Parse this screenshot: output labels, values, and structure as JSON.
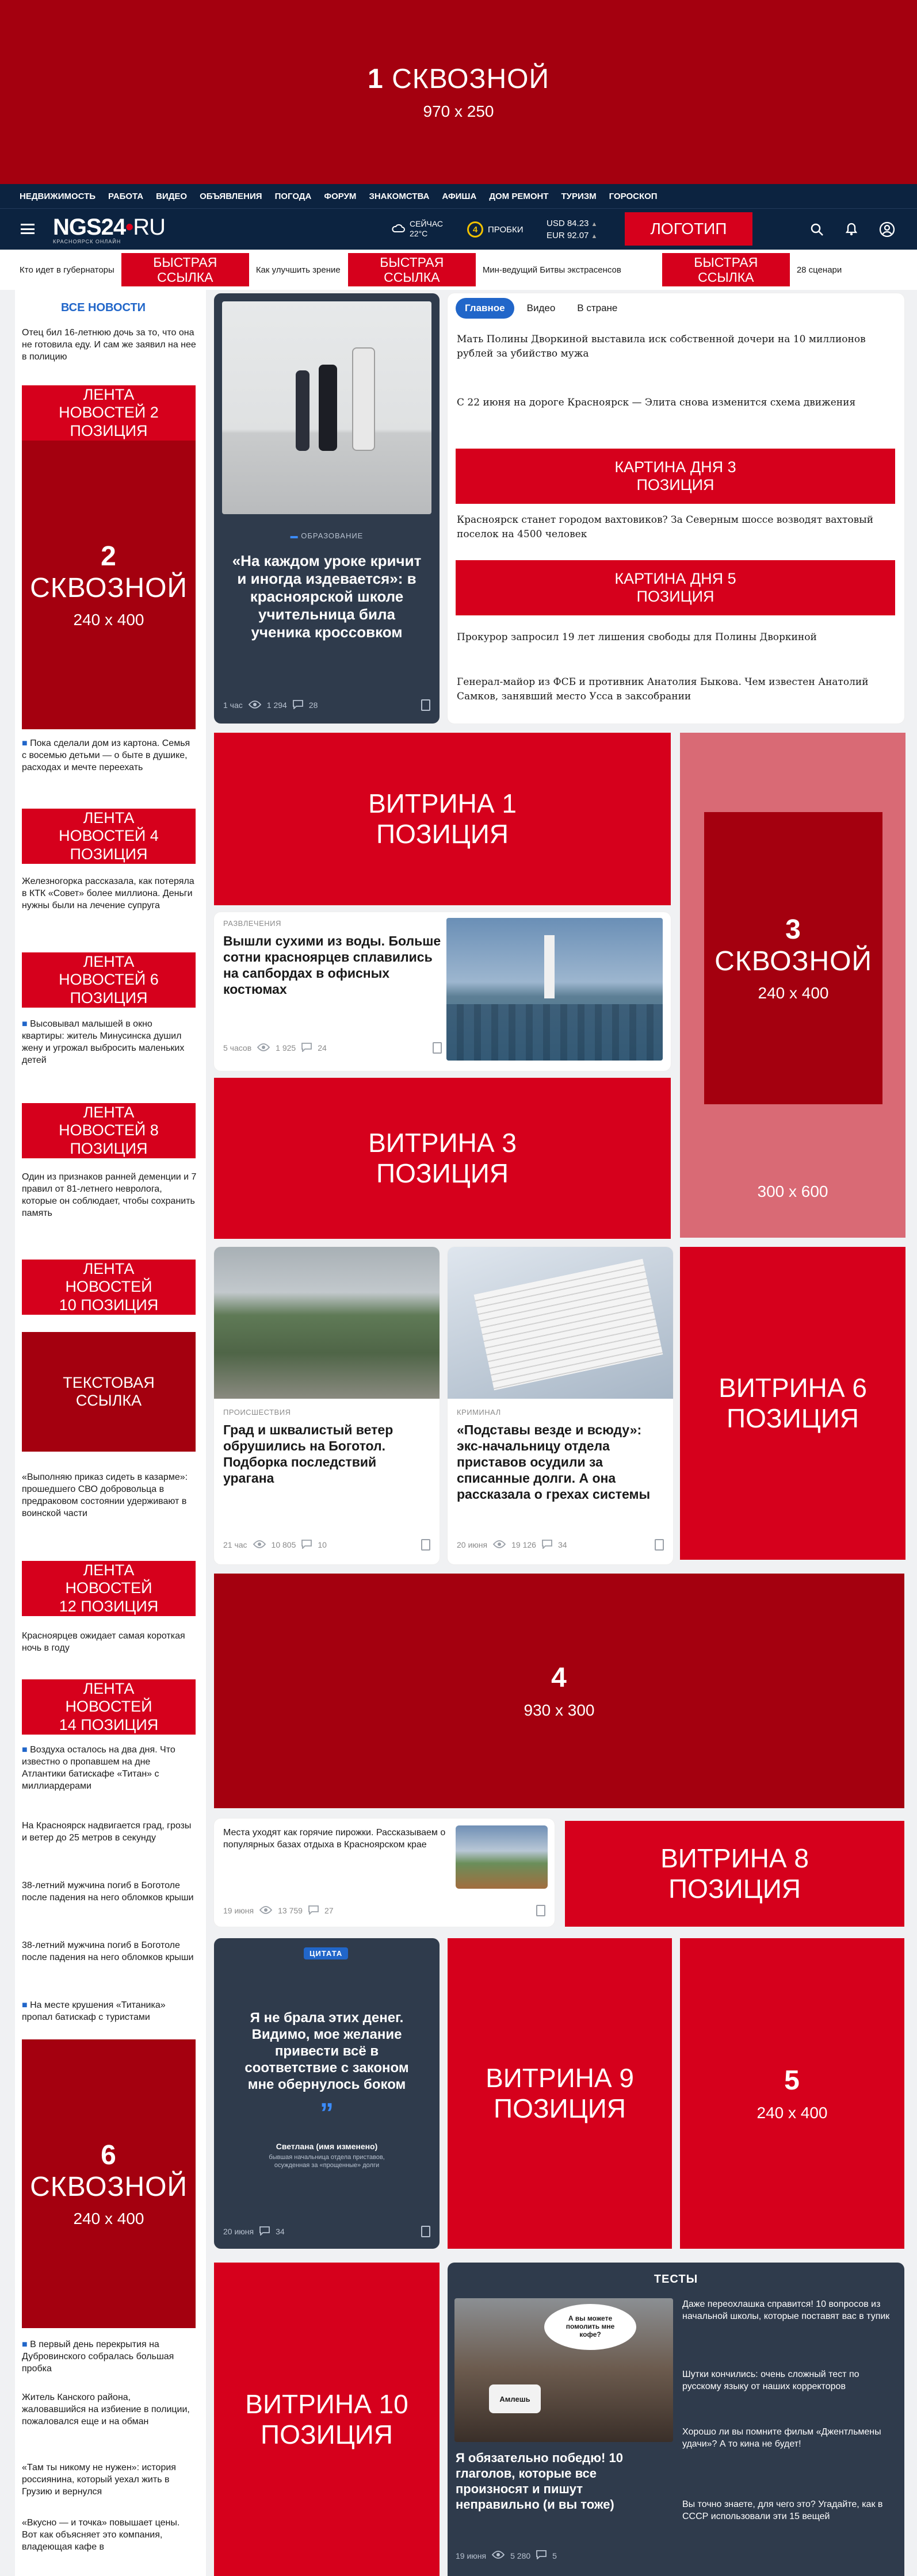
{
  "ads": {
    "top": {
      "num": "1",
      "label": "СКВОЗНОЙ",
      "size": "970 x 250"
    },
    "side2": {
      "num": "2",
      "label": "СКВОЗНОЙ",
      "size": "240 x 400"
    },
    "right3": {
      "num": "3",
      "label": "СКВОЗНОЙ",
      "size": "240 x 400",
      "outer": "300 x 600"
    },
    "wide4": {
      "num": "4",
      "size": "930 x 300"
    },
    "five": {
      "num": "5",
      "size": "240 x 400"
    },
    "side6": {
      "num": "6",
      "label": "СКВОЗНОЙ",
      "size": "240 x 400"
    }
  },
  "topnav": [
    "НЕДВИЖИМОСТЬ",
    "РАБОТА",
    "ВИДЕО",
    "ОБЪЯВЛЕНИЯ",
    "ПОГОДА",
    "ФОРУМ",
    "ЗНАКОМСТВА",
    "АФИША",
    "ДОМ РЕМОНТ",
    "ТУРИЗМ",
    "ГОРОСКОП"
  ],
  "header": {
    "logo": "NGS24",
    "logo_dot": "•",
    "logo_ru": "RU",
    "logo_sub": "КРАСНОЯРСК ОНЛАЙН",
    "weather_label": "СЕЙЧАС",
    "weather_temp": "22°C",
    "traffic_num": "4",
    "traffic_label": "ПРОБКИ",
    "usd": "USD 84.23",
    "eur": "EUR 92.07",
    "logo_btn": "ЛОГОТИП"
  },
  "quicklinks": [
    {
      "text": "Кто идет в губернаторы",
      "ad": false
    },
    {
      "text": "БЫСТРАЯ ССЫЛКА",
      "ad": true
    },
    {
      "text": "Как улучшить зрение",
      "ad": false
    },
    {
      "text": "БЫСТРАЯ ССЫЛКА",
      "ad": true
    },
    {
      "text": "Мин-ведущий Битвы экстрасенсов",
      "ad": false
    },
    {
      "text": "БЫСТРАЯ ССЫЛКА",
      "ad": true
    },
    {
      "text": "28 сценари",
      "ad": false
    }
  ],
  "sidebar": {
    "all_news": "ВСЕ НОВОСТИ",
    "items": [
      {
        "type": "text",
        "text": "Отец бил 16-летнюю дочь за то, что она не готовила еду. И сам же заявил на нее в полицию"
      },
      {
        "type": "ad",
        "text": "ЛЕНТА НОВОСТЕЙ 2 ПОЗИЦИЯ"
      },
      {
        "type": "text",
        "text": "Пока сделали дом из картона. Семья с восемью детьми — о быте в душике, расходах и мечте переехать"
      },
      {
        "type": "ad",
        "text": "ЛЕНТА НОВОСТЕЙ 4 ПОЗИЦИЯ"
      },
      {
        "type": "text",
        "text": "Железногорка рассказала, как потеряла в КТК «Совет» более миллиона. Деньги нужны были на лечение супруга"
      },
      {
        "type": "ad",
        "text": "ЛЕНТА НОВОСТЕЙ 6 ПОЗИЦИЯ"
      },
      {
        "type": "text",
        "text": "Высовывал малышей в окно квартиры: житель Минусинска душил жену и угрожал выбросить маленьких детей"
      },
      {
        "type": "ad",
        "text": "ЛЕНТА НОВОСТЕЙ 8 ПОЗИЦИЯ"
      },
      {
        "type": "text",
        "text": "Один из признаков ранней деменции и 7 правил от 81-летнего невролога, которые он соблюдает, чтобы сохранить память"
      },
      {
        "type": "ad",
        "text": "ЛЕНТА НОВОСТЕЙ 10 ПОЗИЦИЯ"
      },
      {
        "type": "ad",
        "text": "ТЕКСТОВАЯ ССЫЛКА"
      },
      {
        "type": "text",
        "text": "«Выполняю приказ сидеть в казарме»: прошедшего СВО добровольца в предраковом состоянии удерживают в воинской части"
      },
      {
        "type": "ad",
        "text": "ЛЕНТА НОВОСТЕЙ 12 ПОЗИЦИЯ"
      },
      {
        "type": "text",
        "text": "Красноярцев ожидает самая короткая ночь в году"
      },
      {
        "type": "ad",
        "text": "ЛЕНТА НОВОСТЕЙ 14 ПОЗИЦИЯ"
      },
      {
        "type": "text",
        "text": "Воздуха осталось на два дня. Что известно о пропавшем на дне Атлантики батискафе «Титан» с миллиардерами"
      },
      {
        "type": "text",
        "text": "На Красноярск надвигается град, грозы и ветер до 25 метров в секунду"
      },
      {
        "type": "text",
        "text": "38-летний мужчина погиб в Боготоле после падения на него обломков крыши"
      },
      {
        "type": "text",
        "text": "38-летний мужчина погиб в Боготоле после падения на него обломков крыши"
      },
      {
        "type": "text",
        "text": "На месте крушения «Титаника» пропал батискаф с туристами"
      },
      {
        "type": "text",
        "text": "В первый день перекрытия на Дубровинского собралась большая пробка"
      },
      {
        "type": "text",
        "text": "Житель Канского района, жаловавшийся на избиение в полиции, пожаловался еще и на обман"
      },
      {
        "type": "text",
        "text": "«Там ты никому не нужен»: история россиянина, который уехал жить в Грузию и вернулся"
      },
      {
        "type": "text",
        "text": "«Вкусно — и точка» повышает цены. Вот как объясняет это компания, владеющая кафе в"
      }
    ]
  },
  "hero": {
    "category": "ОБРАЗОВАНИЕ",
    "title": "«На каждом уроке кричит и иногда издевается»: в красноярской школе учительница била ученика кроссовком",
    "time": "1 час",
    "views": "1 294",
    "comments": "28"
  },
  "tabs": [
    "Главное",
    "Видео",
    "В стране"
  ],
  "headlines": [
    {
      "type": "text",
      "text": "Мать Полины Дворкиной выставила иск собственной дочери на 10 миллионов рублей за убийство мужа"
    },
    {
      "type": "text",
      "text": "С 22 июня на дороге Красноярск — Элита снова изменится схема движения"
    },
    {
      "type": "ad",
      "text": "КАРТИНА ДНЯ 3 ПОЗИЦИЯ"
    },
    {
      "type": "text",
      "text": "Красноярск станет городом вахтовиков? За Северным шоссе возводят вахтовый поселок на 4500 человек"
    },
    {
      "type": "ad",
      "text": "КАРТИНА ДНЯ 5 ПОЗИЦИЯ"
    },
    {
      "type": "text",
      "text": "Прокурор запросил 19 лет лишения свободы для Полины Дворкиной"
    },
    {
      "type": "text",
      "text": "Генерал-майор из ФСБ и противник Анатолия Быкова. Чем известен Анатолий Самков, занявший место Усса в заксобрании"
    }
  ],
  "vitrina": {
    "v1": "ВИТРИНА 1 ПОЗИЦИЯ",
    "v3": "ВИТРИНА 3 ПОЗИЦИЯ",
    "v6": "ВИТРИНА 6 ПОЗИЦИЯ",
    "v8": "ВИТРИНА 8 ПОЗИЦИЯ",
    "v9": "ВИТРИНА 9 ПОЗИЦИЯ",
    "v10": "ВИТРИНА 10 ПОЗИЦИЯ"
  },
  "sup": {
    "category": "РАЗВЛЕЧЕНИЯ",
    "title": "Вышли сухими из воды. Больше сотни красноярцев сплавились на сапбордах в офисных костюмах",
    "time": "5 часов",
    "views": "1 925",
    "comments": "24"
  },
  "storm": {
    "category": "ПРОИСШЕСТВИЯ",
    "title": "Град и шквалистый ветер обрушились на Боготол. Подборка последствий урагана",
    "time": "21 час",
    "views": "10 805",
    "comments": "10"
  },
  "bailiff": {
    "category": "КРИМИНАЛ",
    "title": "«Подставы везде и всюду»: экс-начальницу отдела приставов осудили за списанные долги. А она рассказала о грехах системы",
    "time": "20 июня",
    "views": "19 126",
    "comments": "34"
  },
  "pies": {
    "text": "Места уходят как горячие пирожки. Рассказываем о популярных базах отдыха в Красноярском крае",
    "time": "19 июня",
    "views": "13 759",
    "comments": "27"
  },
  "quote": {
    "badge": "ЦИТАТА",
    "text": "Я не брала этих денег. Видимо, мое желание привести всё в соответствие с законом мне обернулось боком",
    "author": "Светлана (имя изменено)",
    "author_desc": "бывшая начальница отдела приставов, осужденная за «прощенные» долги",
    "time": "20 июня",
    "comments": "34"
  },
  "tests": {
    "title": "ТЕСТЫ",
    "bubble": "А вы можете помолить мне кофе?",
    "cup": "Амлешь",
    "main_title": "Я обязательно победю! 10 глаголов, которые все произносят и пишут неправильно (и вы тоже)",
    "time": "19 июня",
    "views": "5 280",
    "comments": "5",
    "items": [
      "Даже переохлашка справится! 10 вопросов из начальной школы, которые поставят вас в тупик",
      "Шутки кончились: очень сложный тест по русскому языку от наших корректоров",
      "Хорошо ли вы помните фильм «Джентльмены удачи»? А то кина не будет!",
      "Вы точно знаете, для чего это? Угадайте, как в СССР использовали эти 15 вещей"
    ]
  }
}
